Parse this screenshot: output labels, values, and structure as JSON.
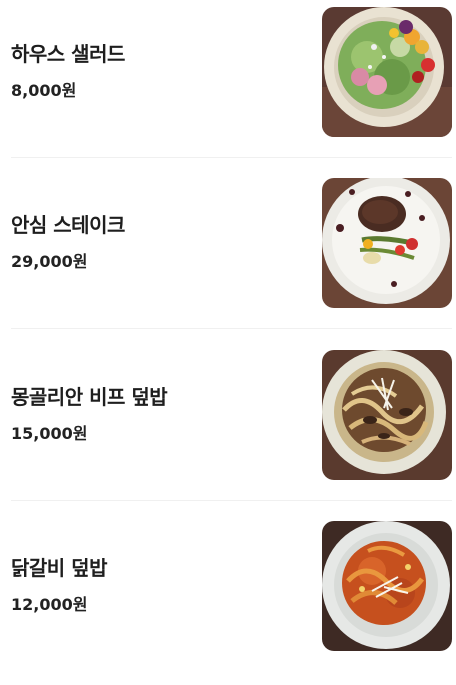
{
  "menu": {
    "items": [
      {
        "name": "하우스 샐러드",
        "price": "8,000원",
        "image": "house-salad-photo"
      },
      {
        "name": "안심 스테이크",
        "price": "29,000원",
        "image": "tenderloin-steak-photo"
      },
      {
        "name": "몽골리안 비프 덮밥",
        "price": "15,000원",
        "image": "mongolian-beef-rice-bowl-photo"
      },
      {
        "name": "닭갈비 덮밥",
        "price": "12,000원",
        "image": "dakgalbi-rice-bowl-photo"
      }
    ]
  }
}
